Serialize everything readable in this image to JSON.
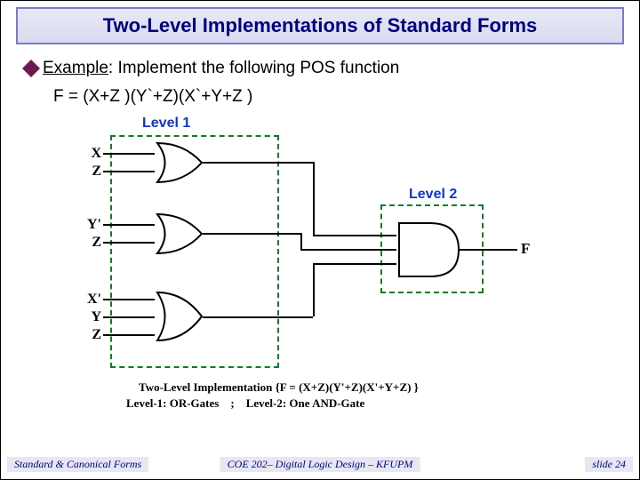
{
  "title": "Two-Level Implementations of Standard Forms",
  "bullet": {
    "label1": "Example",
    "label2": ": Implement the following POS function"
  },
  "formula": "F = (X+Z )(Y`+Z)(X`+Y+Z )",
  "levels": {
    "l1": "Level 1",
    "l2": "Level 2"
  },
  "inputs": {
    "g1a": "X",
    "g1b": "Z",
    "g2a": "Y'",
    "g2b": "Z",
    "g3a": "X'",
    "g3b": "Y",
    "g3c": "Z"
  },
  "output": "F",
  "caption1": "Two-Level Implementation {F = (X+Z)(Y'+Z)(X'+Y+Z) }",
  "caption2_a": "Level-1: OR-Gates",
  "caption2_sep": ";",
  "caption2_b": "Level-2: One AND-Gate",
  "footer": {
    "left": "Standard & Canonical Forms",
    "center": "COE 202– Digital Logic Design – KFUPM",
    "right": "slide 24"
  },
  "chart_data": {
    "type": "diagram",
    "description": "Two-level POS logic circuit",
    "level1": {
      "gate_type": "OR",
      "gates": [
        {
          "id": "OR1",
          "inputs": [
            "X",
            "Z"
          ]
        },
        {
          "id": "OR2",
          "inputs": [
            "Y'",
            "Z"
          ]
        },
        {
          "id": "OR3",
          "inputs": [
            "X'",
            "Y",
            "Z"
          ]
        }
      ]
    },
    "level2": {
      "gate_type": "AND",
      "gates": [
        {
          "id": "AND1",
          "inputs": [
            "OR1",
            "OR2",
            "OR3"
          ],
          "output": "F"
        }
      ]
    },
    "function": "F = (X+Z)(Y'+Z)(X'+Y+Z)"
  }
}
